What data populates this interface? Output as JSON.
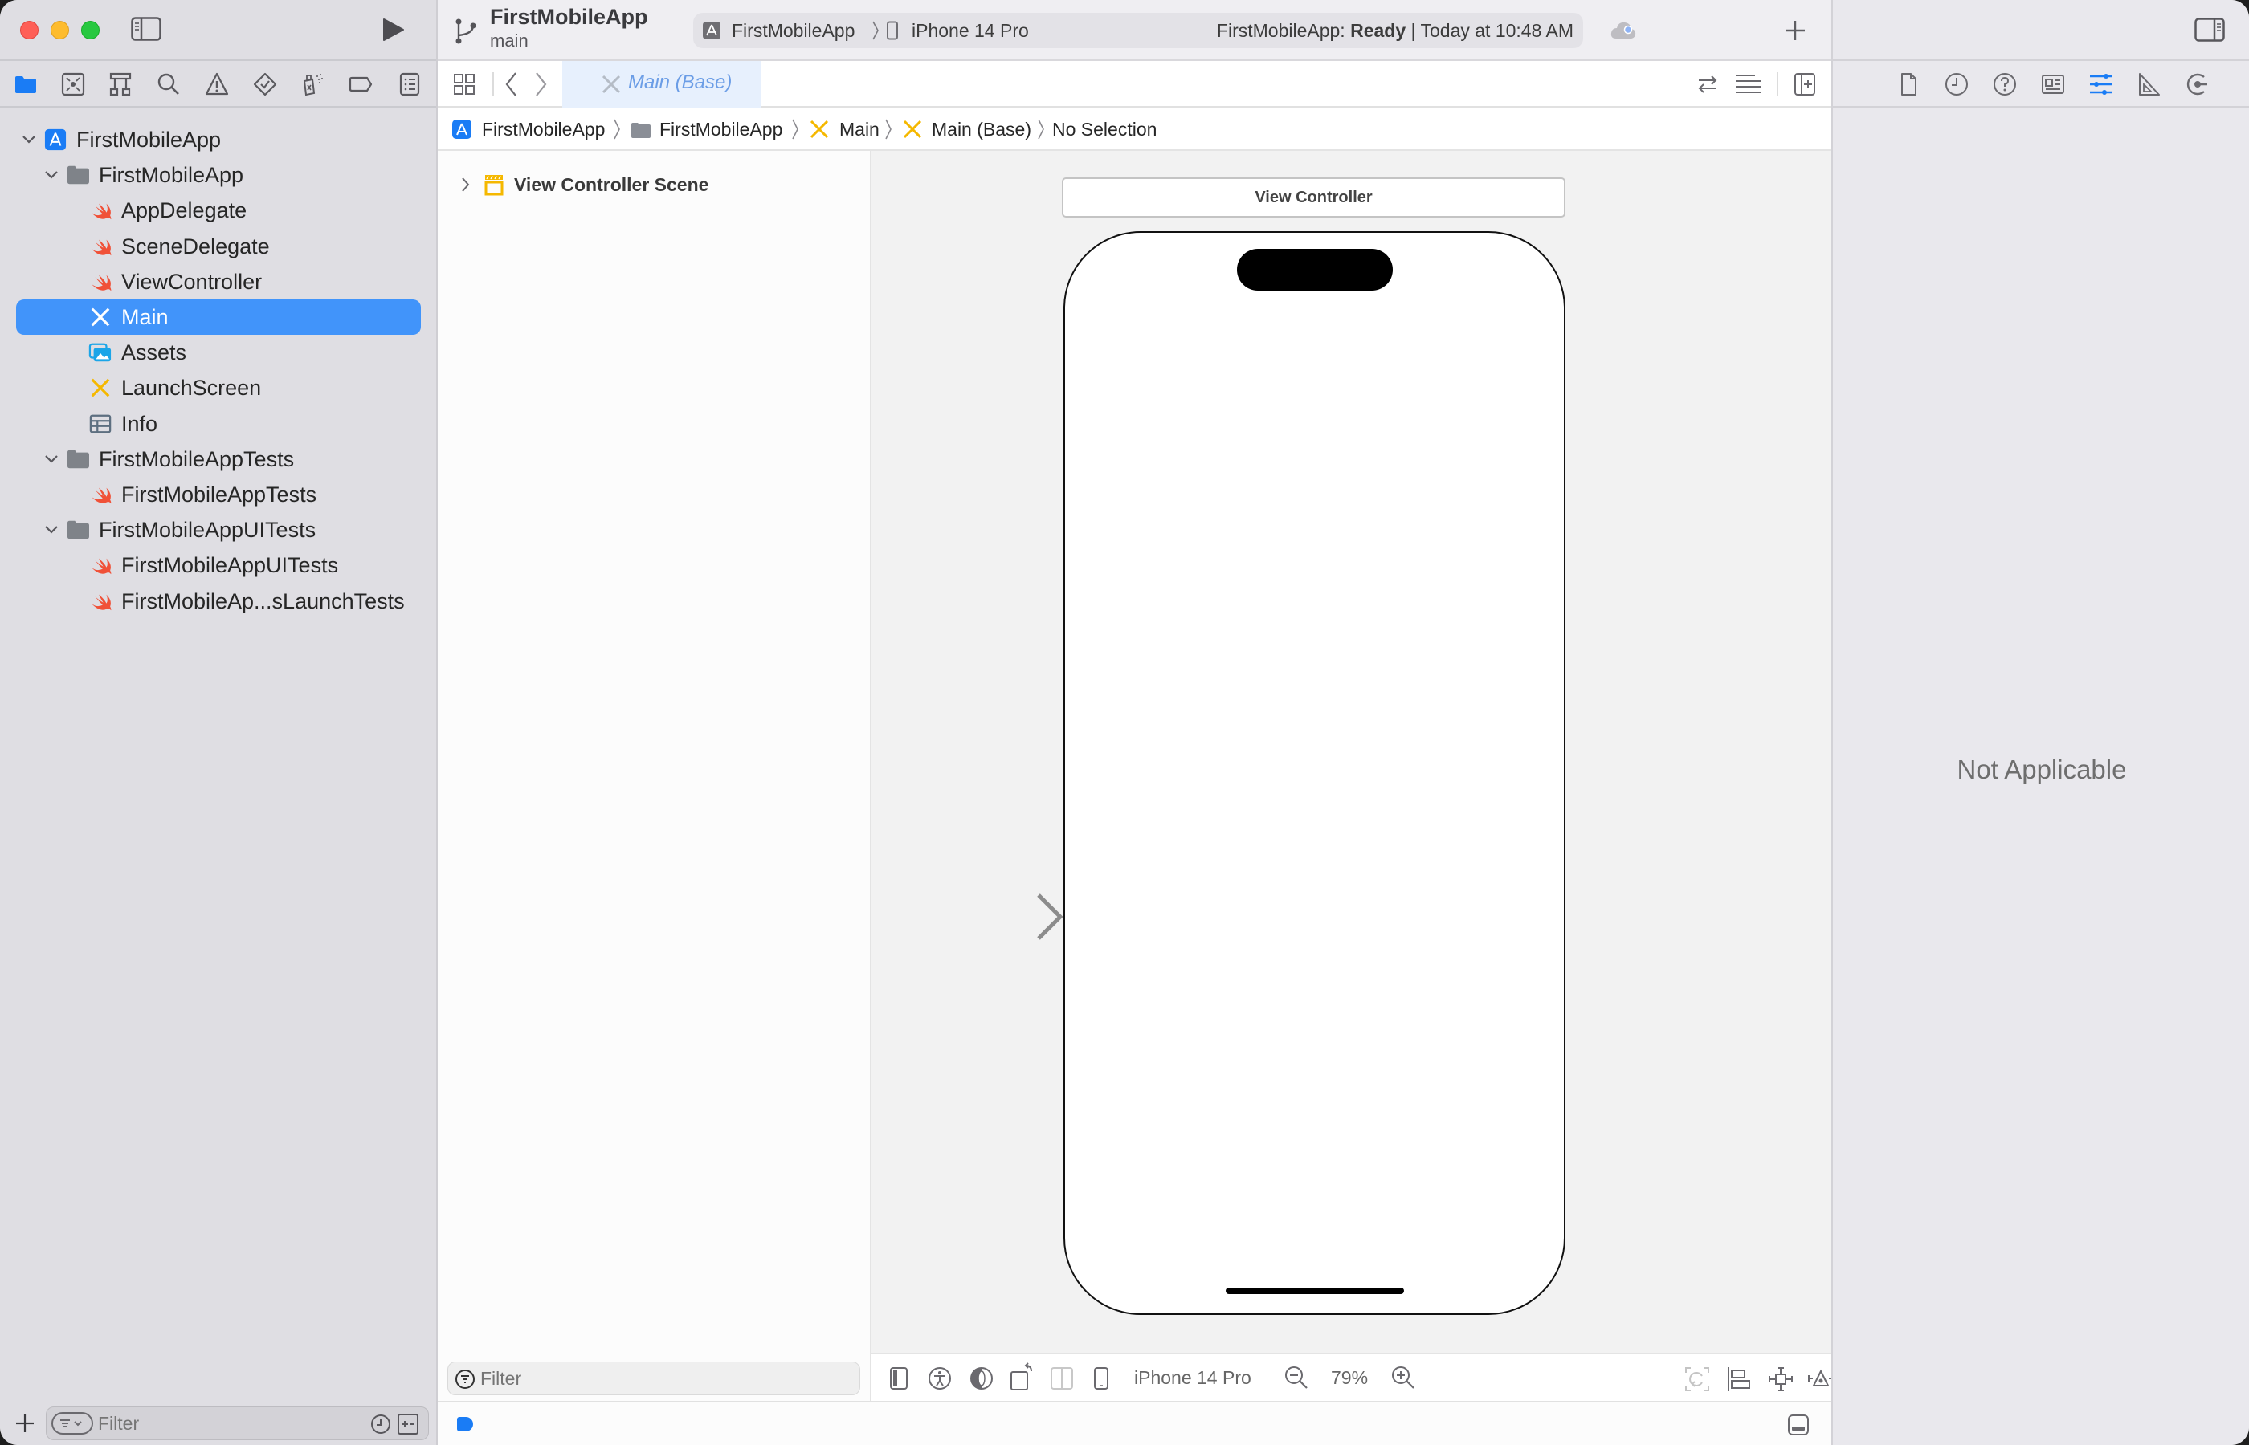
{
  "window": {
    "traffic_lights": {
      "close": "#fe5f57",
      "minimize": "#febc2e",
      "zoom": "#28c840"
    }
  },
  "toolbar": {
    "project_name": "FirstMobileApp",
    "branch": "main",
    "scheme_target": "FirstMobileApp",
    "scheme_device": "iPhone 14 Pro",
    "status_prefix": "FirstMobileApp:",
    "status_state": "Ready",
    "status_separator": "|",
    "status_time": "Today at 10:48 AM",
    "icons": {
      "sidebar_toggle": "sidebar-left-icon",
      "run": "play-icon",
      "source_control": "branch-icon",
      "cloud_status": "cloud-icon",
      "add": "plus-icon",
      "inspector_toggle": "sidebar-right-icon"
    }
  },
  "navigator": {
    "tabs": [
      {
        "name": "project-navigator",
        "icon": "folder-icon",
        "active": true
      },
      {
        "name": "source-control-navigator",
        "icon": "source-control-icon",
        "active": false
      },
      {
        "name": "symbol-navigator",
        "icon": "hierarchy-icon",
        "active": false
      },
      {
        "name": "find-navigator",
        "icon": "search-icon",
        "active": false
      },
      {
        "name": "issue-navigator",
        "icon": "warning-icon",
        "active": false
      },
      {
        "name": "test-navigator",
        "icon": "test-diamond-icon",
        "active": false
      },
      {
        "name": "debug-navigator",
        "icon": "spray-icon",
        "active": false
      },
      {
        "name": "breakpoint-navigator",
        "icon": "breakpoint-tag-icon",
        "active": false
      },
      {
        "name": "report-navigator",
        "icon": "report-list-icon",
        "active": false
      }
    ],
    "tree": [
      {
        "label": "FirstMobileApp",
        "type": "project",
        "level": 0,
        "expanded": true
      },
      {
        "label": "FirstMobileApp",
        "type": "folder",
        "level": 1,
        "expanded": true
      },
      {
        "label": "AppDelegate",
        "type": "swift",
        "level": 2
      },
      {
        "label": "SceneDelegate",
        "type": "swift",
        "level": 2
      },
      {
        "label": "ViewController",
        "type": "swift",
        "level": 2
      },
      {
        "label": "Main",
        "type": "storyboard",
        "level": 2,
        "selected": true
      },
      {
        "label": "Assets",
        "type": "assets",
        "level": 2
      },
      {
        "label": "LaunchScreen",
        "type": "storyboard",
        "level": 2
      },
      {
        "label": "Info",
        "type": "plist",
        "level": 2
      },
      {
        "label": "FirstMobileAppTests",
        "type": "folder",
        "level": 1,
        "expanded": true
      },
      {
        "label": "FirstMobileAppTests",
        "type": "swift",
        "level": 2
      },
      {
        "label": "FirstMobileAppUITests",
        "type": "folder",
        "level": 1,
        "expanded": true
      },
      {
        "label": "FirstMobileAppUITests",
        "type": "swift",
        "level": 2
      },
      {
        "label": "FirstMobileAp...sLaunchTests",
        "type": "swift",
        "level": 2
      }
    ],
    "filter_placeholder": "Filter"
  },
  "editor": {
    "tab": {
      "label": "Main (Base)"
    },
    "jump_bar": [
      "FirstMobileApp",
      "FirstMobileApp",
      "Main",
      "Main (Base)",
      "No Selection"
    ],
    "outline": {
      "items": [
        {
          "label": "View Controller Scene",
          "expanded": false
        }
      ],
      "filter_placeholder": "Filter"
    },
    "canvas": {
      "scene_title": "View Controller",
      "device": "iPhone 14 Pro",
      "zoom": "79%"
    }
  },
  "inspector": {
    "tabs": [
      {
        "name": "file-inspector",
        "icon": "file-icon",
        "active": false
      },
      {
        "name": "history-inspector",
        "icon": "clock-icon",
        "active": false
      },
      {
        "name": "quick-help-inspector",
        "icon": "question-icon",
        "active": false
      },
      {
        "name": "identity-inspector",
        "icon": "identity-card-icon",
        "active": false
      },
      {
        "name": "attributes-inspector",
        "icon": "sliders-icon",
        "active": true
      },
      {
        "name": "size-inspector",
        "icon": "ruler-icon",
        "active": false
      },
      {
        "name": "connections-inspector",
        "icon": "connection-icon",
        "active": false
      }
    ],
    "empty_message": "Not Applicable"
  },
  "colors": {
    "accent": "#1a7cf5",
    "selection": "#4194fa",
    "swift_orange": "#f05138",
    "storyboard_yellow": "#f5b800",
    "assets_blue": "#1ba5e8"
  }
}
